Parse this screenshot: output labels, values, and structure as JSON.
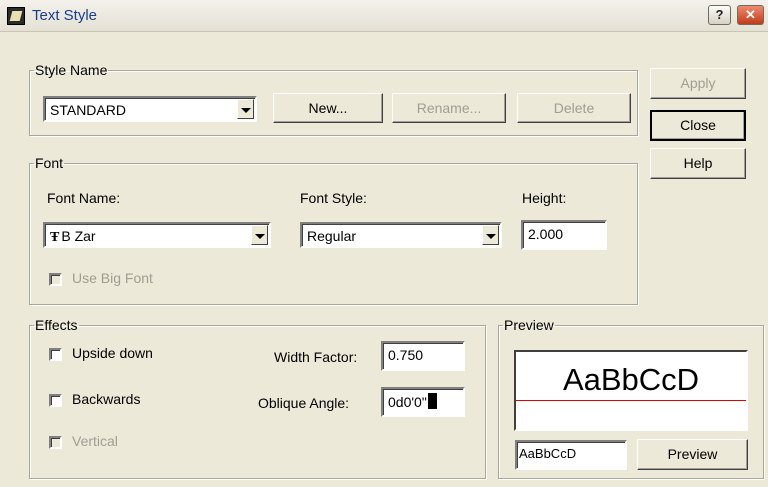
{
  "window": {
    "title": "Text Style",
    "help_button": "?",
    "close_button": "✕"
  },
  "style_name": {
    "legend": "Style Name",
    "selected": "STANDARD",
    "new_button": "New...",
    "rename_button": "Rename...",
    "delete_button": "Delete"
  },
  "actions": {
    "apply": "Apply",
    "close": "Close",
    "help": "Help"
  },
  "font": {
    "legend": "Font",
    "name_label": "Font Name:",
    "name_value": "B Zar",
    "name_icon": "truetype-font-icon",
    "style_label": "Font Style:",
    "style_value": "Regular",
    "height_label": "Height:",
    "height_value": "2.000",
    "big_font_label": "Use Big Font"
  },
  "effects": {
    "legend": "Effects",
    "upside_down": "Upside down",
    "backwards": "Backwards",
    "vertical": "Vertical",
    "width_factor_label": "Width Factor:",
    "width_factor_value": "0.750",
    "oblique_label": "Oblique Angle:",
    "oblique_value": "0d0'0\""
  },
  "preview": {
    "legend": "Preview",
    "sample": "AaBbCcD",
    "input_value": "AaBbCcD",
    "button": "Preview"
  },
  "colors": {
    "dialog_bg": "#ece9d8",
    "title_text": "#1b3d8f",
    "preview_baseline": "#e00000"
  }
}
